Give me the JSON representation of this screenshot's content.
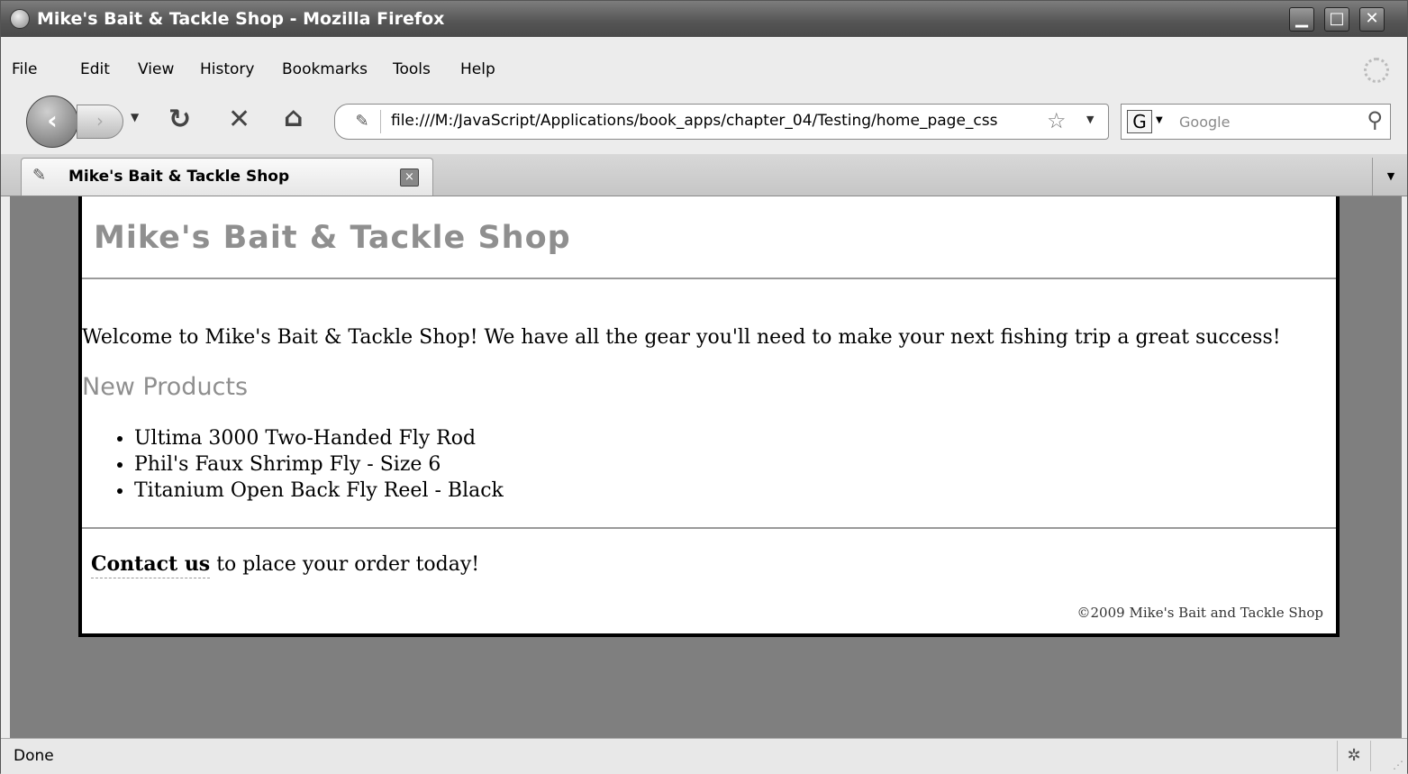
{
  "window": {
    "title": "Mike's Bait & Tackle Shop - Mozilla Firefox",
    "min_glyph": "▁",
    "max_glyph": "□",
    "close_glyph": "✕"
  },
  "menu": [
    "File",
    "Edit",
    "View",
    "History",
    "Bookmarks",
    "Tools",
    "Help"
  ],
  "toolbar": {
    "back_glyph": "‹",
    "forward_glyph": "›",
    "reload_glyph": "↻",
    "stop_glyph": "✕",
    "home_glyph": "⌂",
    "url": "file:///M:/JavaScript/Applications/book_apps/chapter_04/Testing/home_page_css",
    "bookmark_glyph": "☆",
    "search_engine_glyph": "G",
    "search_placeholder": "Google",
    "search_glyph": "⚲"
  },
  "tab": {
    "label": "Mike's Bait & Tackle Shop",
    "close_glyph": "×"
  },
  "page": {
    "site_title": "Mike's Bait & Tackle Shop",
    "welcome": "Welcome to Mike's Bait & Tackle Shop! We have all the gear you'll need to make your next fishing trip a great success!",
    "section_title": "New Products",
    "products": [
      "Ultima 3000 Two-Handed Fly Rod",
      "Phil's Faux Shrimp Fly - Size 6",
      "Titanium Open Back Fly Reel - Black"
    ],
    "contact_link": "Contact us",
    "contact_rest": " to place your order today!",
    "copyright": "©2009 Mike's Bait and Tackle Shop"
  },
  "status": {
    "text": "Done"
  },
  "colors": {
    "heading_gray": "#8f8f8f",
    "content_bg": "#7f7f7f",
    "titlebar": "#545454"
  }
}
